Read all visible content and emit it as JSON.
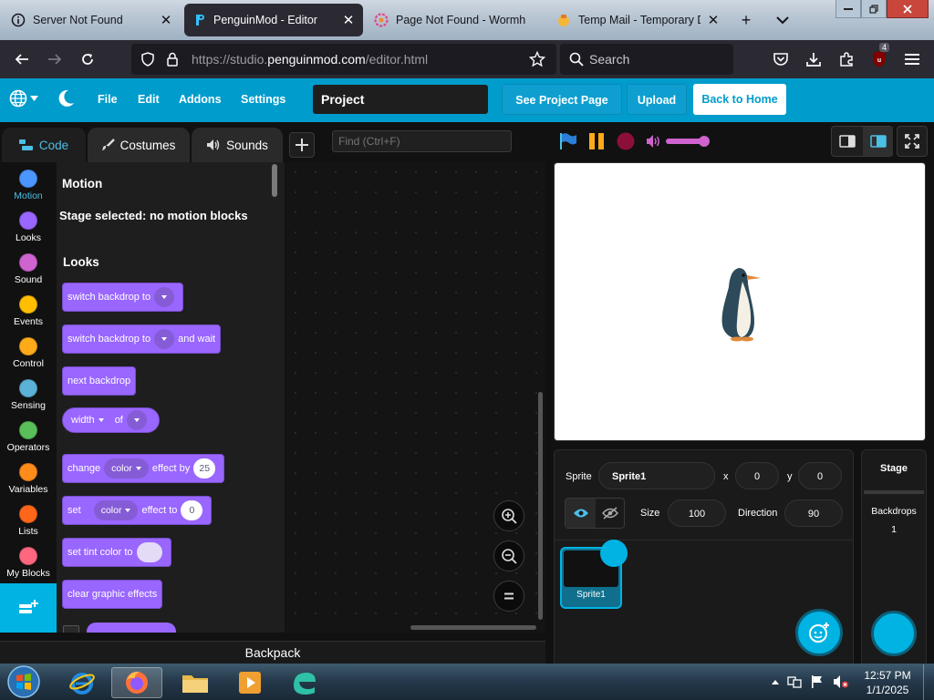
{
  "browser": {
    "tabs": [
      {
        "label": "Server Not Found",
        "active": false,
        "icon": "info-icon"
      },
      {
        "label": "PenguinMod - Editor",
        "active": true,
        "icon": "penguinmod-icon"
      },
      {
        "label": "Page Not Found - Wormh",
        "active": false,
        "icon": "wormhole-icon"
      },
      {
        "label": "Temp Mail - Temporary Di",
        "active": false,
        "icon": "tempmail-icon"
      }
    ],
    "new_tab_glyph": "+",
    "close_glyph": "✕",
    "url_prefix": "https://studio.",
    "url_domain": "penguinmod.com",
    "url_path": "/editor.html",
    "search_placeholder": "Search",
    "extension_badge": "4"
  },
  "menu": {
    "items": [
      "File",
      "Edit",
      "Addons",
      "Settings"
    ],
    "project_title": "Project",
    "see_project_page": "See Project Page",
    "upload": "Upload",
    "back_home": "Back to Home"
  },
  "editor": {
    "tabs": [
      "Code",
      "Costumes",
      "Sounds"
    ],
    "find_placeholder": "Find (Ctrl+F)",
    "categories": [
      {
        "label": "Motion",
        "color": "#4c97ff"
      },
      {
        "label": "Looks",
        "color": "#9966ff"
      },
      {
        "label": "Sound",
        "color": "#cf63cf"
      },
      {
        "label": "Events",
        "color": "#ffbf00"
      },
      {
        "label": "Control",
        "color": "#ffab19"
      },
      {
        "label": "Sensing",
        "color": "#5cb1d6"
      },
      {
        "label": "Operators",
        "color": "#59c059"
      },
      {
        "label": "Variables",
        "color": "#ff8c1a"
      },
      {
        "label": "Lists",
        "color": "#ff661a"
      },
      {
        "label": "My Blocks",
        "color": "#ff6680"
      }
    ],
    "flyout": {
      "motion_heading": "Motion",
      "motion_note": "Stage selected: no motion blocks",
      "looks_heading": "Looks",
      "blocks": {
        "switch_backdrop": "switch backdrop to",
        "switch_backdrop_wait_a": "switch backdrop to",
        "switch_backdrop_wait_b": "and wait",
        "next_backdrop": "next backdrop",
        "width_of_a": "width",
        "width_of_b": "of",
        "change_effect_a": "change",
        "change_effect_dd": "color",
        "change_effect_b": "effect by",
        "change_effect_val": "25",
        "set_effect_a": "set",
        "set_effect_dd": "color",
        "set_effect_b": "effect to",
        "set_effect_val": "0",
        "set_tint": "set tint color to",
        "clear_effects": "clear graphic effects"
      }
    },
    "backpack": "Backpack"
  },
  "stage_info": {
    "sprite_label": "Sprite",
    "sprite_name": "Sprite1",
    "x_label": "x",
    "x_value": "0",
    "y_label": "y",
    "y_value": "0",
    "size_label": "Size",
    "size_value": "100",
    "direction_label": "Direction",
    "direction_value": "90",
    "sprite_tile_name": "Sprite1",
    "stage_label": "Stage",
    "backdrops_label": "Backdrops",
    "backdrops_count": "1"
  },
  "colors": {
    "accent": "#009ccc",
    "looks_block": "#9966ff"
  },
  "taskbar": {
    "time": "12:57 PM",
    "date": "1/1/2025"
  }
}
